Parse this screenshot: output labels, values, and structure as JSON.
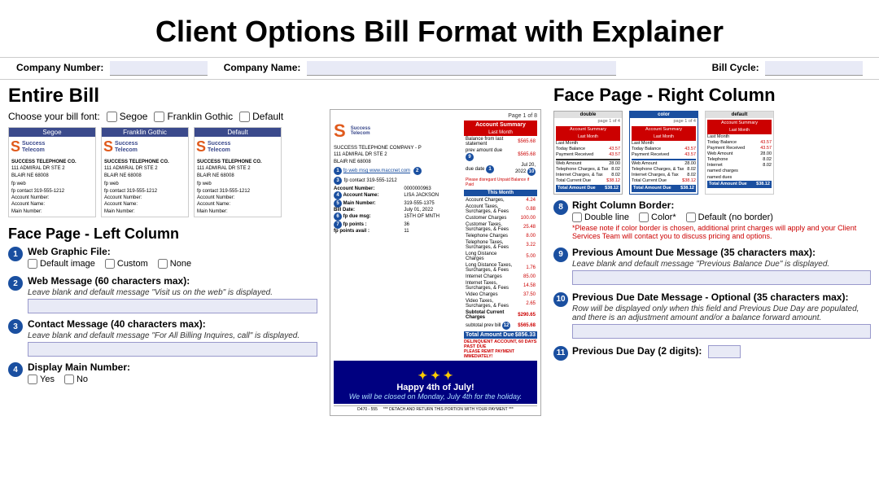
{
  "page": {
    "title": "Client Options Bill Format with Explainer"
  },
  "top_bar": {
    "company_number_label": "Company Number:",
    "company_name_label": "Company Name:",
    "bill_cycle_label": "Bill Cycle:"
  },
  "entire_bill": {
    "title": "Entire Bill",
    "choose_font_label": "Choose your bill font:",
    "font_options": [
      "Segoe",
      "Franklin Gothic",
      "Default"
    ],
    "font_previews": [
      {
        "label": "Segoe",
        "company": "SUCCESS TELEPHONE CO.",
        "address": "111 ADMIRAL DR STE 2",
        "city": "BLAIR NE 68008"
      },
      {
        "label": "Franklin Gothic",
        "company": "SUCCESS TELEPHONE CO.",
        "address": "111 ADMIRAL DR STE 2",
        "city": "BLAIR NE 68008"
      },
      {
        "label": "Default",
        "company": "SUCCESS TELEPHONE CO.",
        "address": "111 ADMIRAL DR STE 2",
        "city": "BLAIR NE 68008"
      }
    ]
  },
  "face_page_left": {
    "title": "Face Page - Left Column",
    "items": [
      {
        "number": "1",
        "title": "Web Graphic File:",
        "options": [
          "Default image",
          "Custom",
          "None"
        ],
        "desc": ""
      },
      {
        "number": "2",
        "title": "Web Message (60 characters max):",
        "desc": "Leave blank and default message \"Visit us on the web\" is displayed."
      },
      {
        "number": "3",
        "title": "Contact Message (40 characters max):",
        "desc": "Leave blank and default message \"For All Billing Inquires, call\" is displayed."
      },
      {
        "number": "4",
        "title": "Display Main Number:",
        "options": [
          "Yes",
          "No"
        ],
        "desc": ""
      }
    ]
  },
  "bill_preview": {
    "page_label": "Page 1 of 8",
    "company": "SUCCESS TELEPHONE COMPANY - P",
    "address": "111 ADMIRAL DR STE 2",
    "city": "BLAIR NE 68008",
    "fp_web": "fp web msg www.maccnet.com",
    "fp_contact": "fp contact 319-555-1212",
    "account_number": "0000000963",
    "account_name": "LISA JACKSON",
    "main_number": "319-555-1375",
    "bill_date": "July 01, 2022",
    "fp_due_msg": "15TH OF MNTH",
    "fp_points": "36",
    "fp_points_avail": "11",
    "account_summary_title": "Account Summary",
    "last_month_title": "Last Month",
    "balance_from_last": "$565.68",
    "prev_amount_due": "$565.68",
    "due_date": "Jul 20, 2022",
    "this_month_title": "This Month",
    "acct_charges": "4.24",
    "taxes_surcharges_fees": "0.88",
    "customer_charges": "100.00",
    "customer_taxes": "25.48",
    "telephone_charges": "8.00",
    "telephone_taxes": "3.22",
    "long_distance_charges": "5.00",
    "long_distance_taxes": "1.76",
    "internet_charges": "85.00",
    "internet_taxes": "14.58",
    "video_charges": "37.50",
    "video_taxes": "2.65",
    "subtotal_current": "$290.65",
    "subtotal_prev": "$565.68",
    "total_amount_due": "$856.33",
    "delinquent_text": "DELINQUENT ACCOUNT, 60 DAYS PAST DUE",
    "please_remit": "PLEASE REMIT PAYMENT IMMEDIATELY!",
    "holiday_text": "Happy 4th of July!",
    "holiday_sub": "We will be closed on Monday, July 4th for the holiday.",
    "footer": "D470 - 555",
    "detach_text": "*** DETACH AND RETURN THIS PORTION WITH YOUR PAYMENT ***"
  },
  "face_page_right": {
    "title": "Face Page - Right Column",
    "previews": [
      {
        "label": "double",
        "page_label": "page 1 of 4"
      },
      {
        "label": "color",
        "page_label": "page 1 of 4"
      },
      {
        "label": "default",
        "page_label": ""
      }
    ],
    "items": [
      {
        "number": "8",
        "title": "Right Column Border:",
        "options": [
          "Double line",
          "Color*",
          "Default (no border)"
        ],
        "asterisk_note": "*Please note if color border is chosen, additional print charges will apply and your Client Services Team will contact you to discuss pricing and options."
      },
      {
        "number": "9",
        "title": "Previous Amount Due Message (35 characters max):",
        "desc": "Leave blank and default message \"Previous Balance Due\" is displayed."
      },
      {
        "number": "10",
        "title": "Previous Due Date Message - Optional (35 characters max):",
        "desc": "Row will be displayed only when this field and Previous Due Day are populated, and there is an adjustment amount and/or a balance forward amount."
      },
      {
        "number": "11",
        "title": "Previous Due Day (2 digits):",
        "desc": ""
      }
    ]
  }
}
